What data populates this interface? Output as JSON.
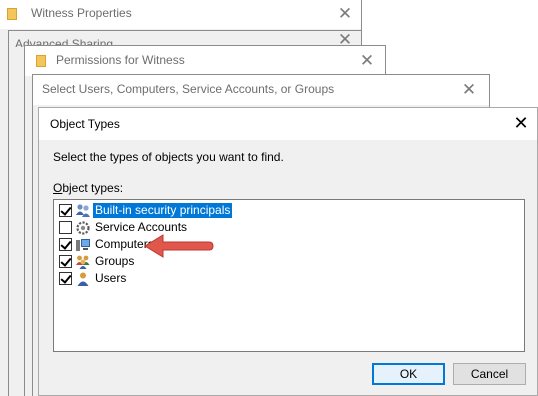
{
  "windows": {
    "witness_properties_title": "Witness Properties",
    "advanced_sharing_title": "Advanced Sharing",
    "permissions_title": "Permissions for Witness",
    "select_users_title": "Select Users, Computers, Service Accounts, or Groups"
  },
  "dialog": {
    "title": "Object Types",
    "instruction": "Select the types of objects you want to find.",
    "list_label_accel": "O",
    "list_label_rest": "bject types:",
    "items": [
      {
        "label": "Built-in security principals",
        "checked": true,
        "selected": true,
        "icon": "security-principals-icon"
      },
      {
        "label": "Service Accounts",
        "checked": false,
        "selected": false,
        "icon": "service-accounts-icon"
      },
      {
        "label": "Computers",
        "checked": true,
        "selected": false,
        "icon": "computer-icon"
      },
      {
        "label": "Groups",
        "checked": true,
        "selected": false,
        "icon": "groups-icon"
      },
      {
        "label": "Users",
        "checked": true,
        "selected": false,
        "icon": "user-icon"
      }
    ],
    "ok_label": "OK",
    "cancel_label": "Cancel"
  },
  "colors": {
    "accent": "#0078d7",
    "arrow": "#e2574c"
  }
}
